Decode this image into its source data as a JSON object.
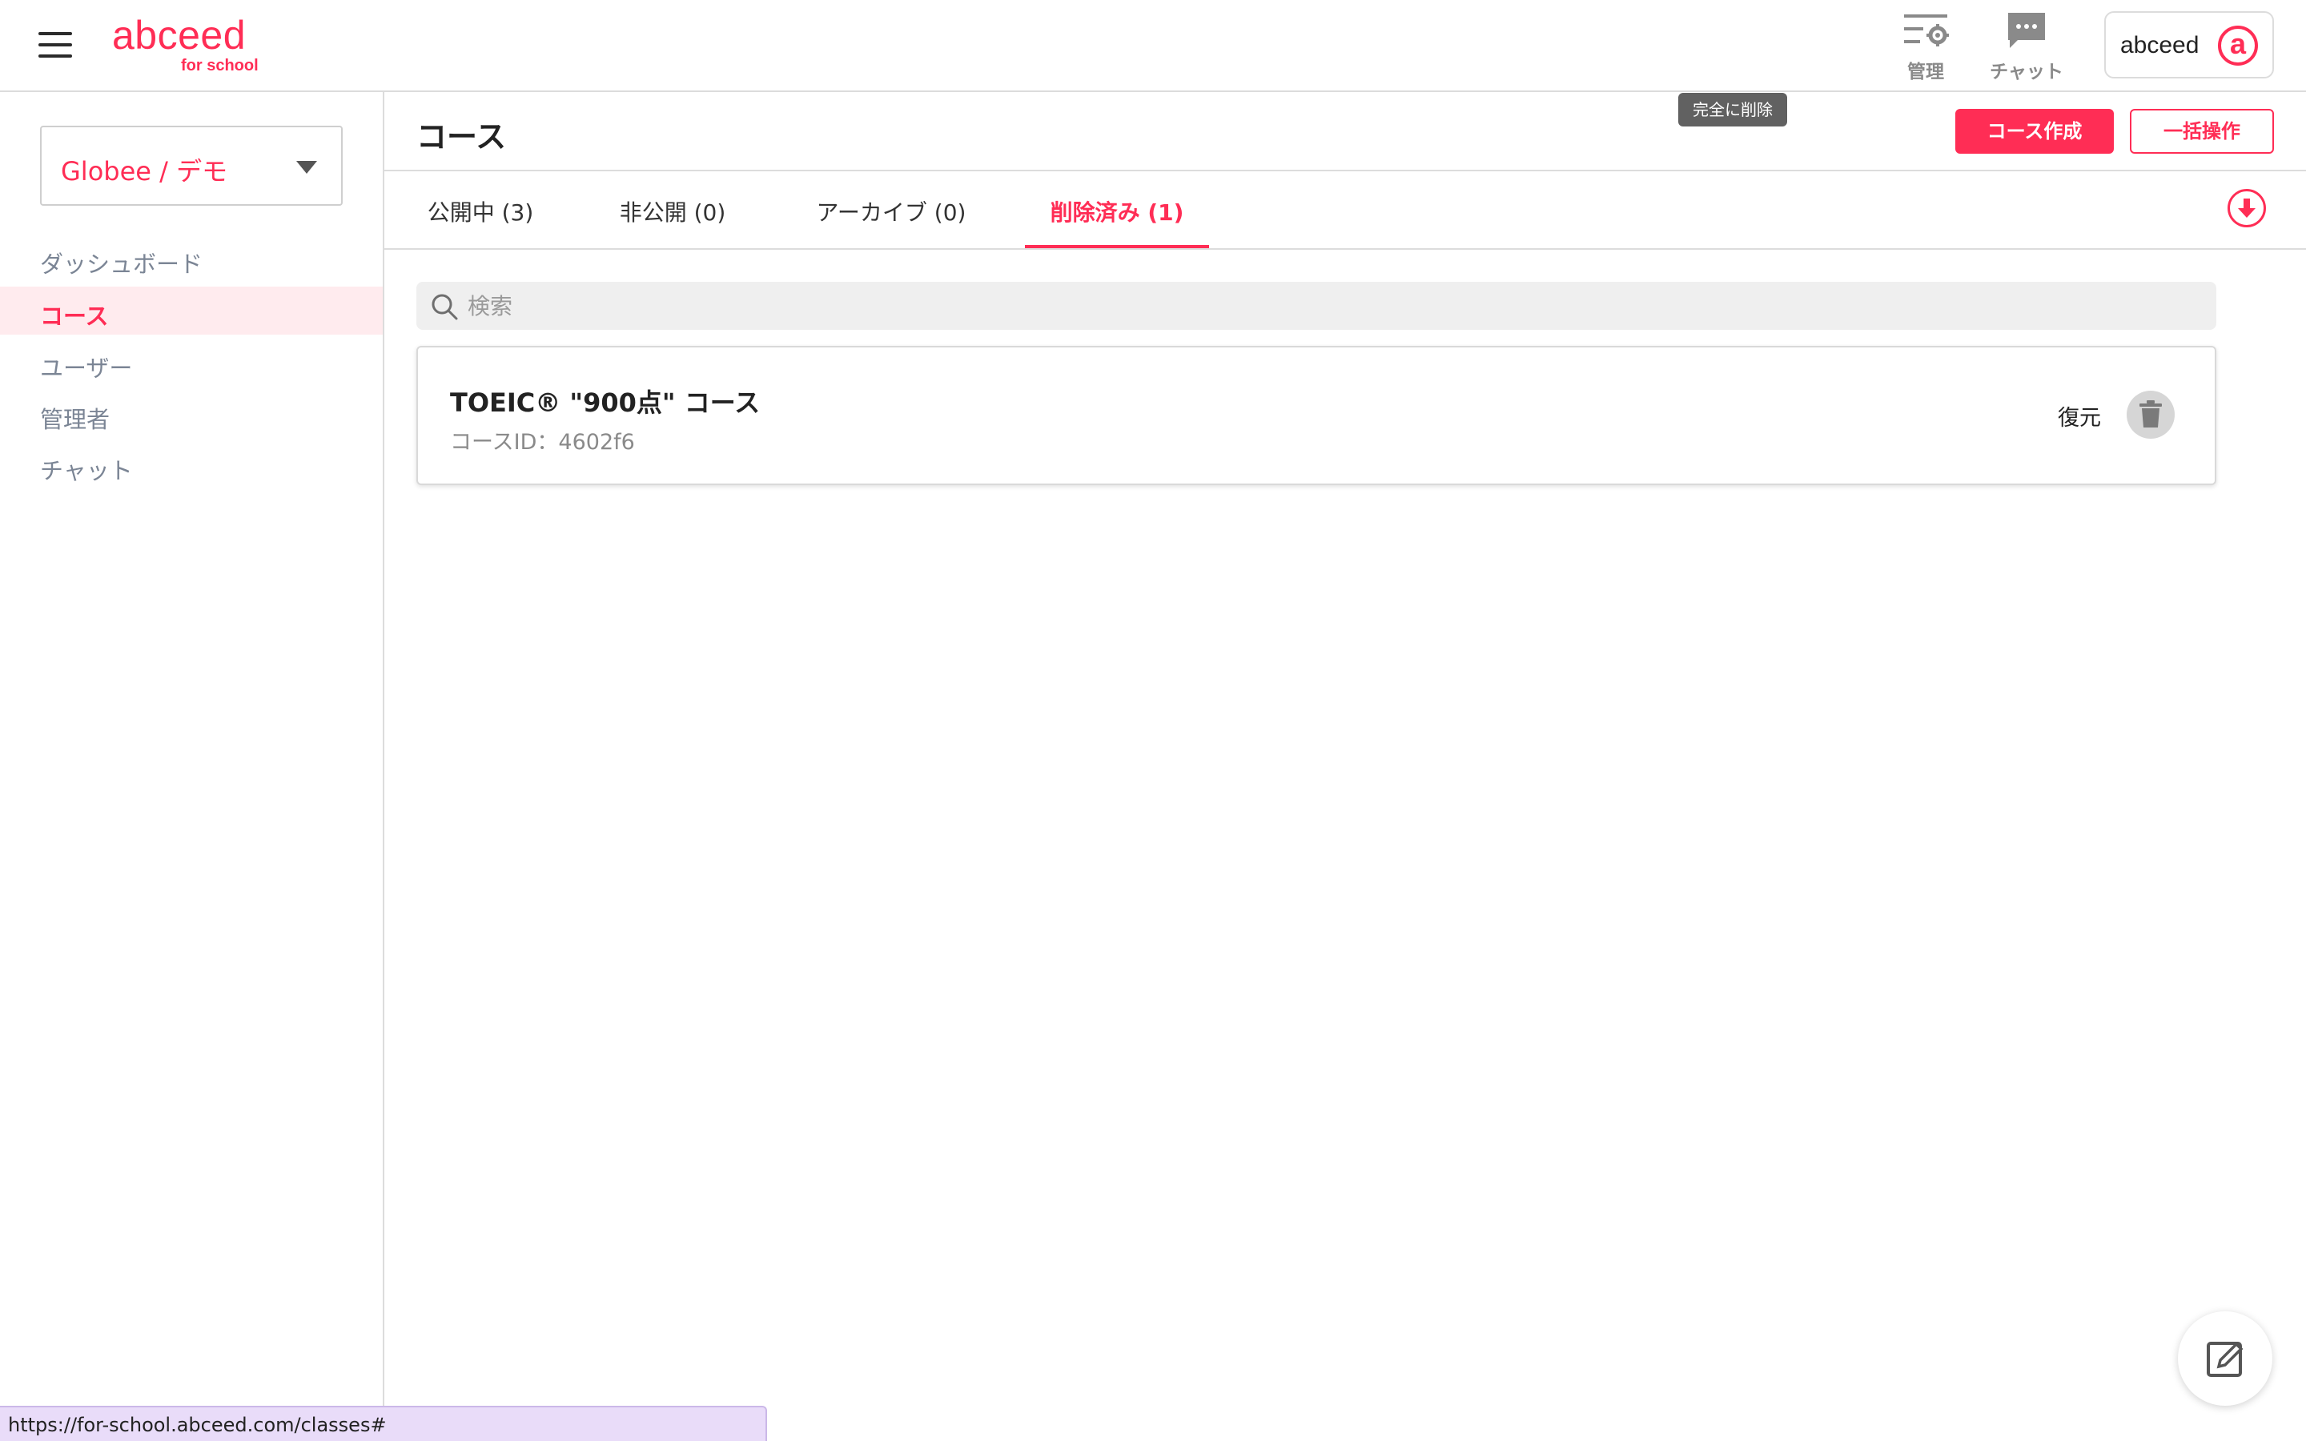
{
  "header": {
    "logo_main": "abceed",
    "logo_sub": "for school",
    "admin_label": "管理",
    "chat_label": "チャット",
    "account_name": "abceed",
    "account_badge": "a"
  },
  "sidebar": {
    "org_select_value": "Globee / デモ",
    "items": [
      {
        "label": "ダッシュボード",
        "active": false
      },
      {
        "label": "コース",
        "active": true
      },
      {
        "label": "ユーザー",
        "active": false
      },
      {
        "label": "管理者",
        "active": false
      },
      {
        "label": "チャット",
        "active": false
      }
    ]
  },
  "main": {
    "title": "コース",
    "create_button": "コース作成",
    "bulk_button": "一括操作",
    "tabs": [
      {
        "label": "公開中 (3)",
        "active": false
      },
      {
        "label": "非公開 (0)",
        "active": false
      },
      {
        "label": "アーカイブ (0)",
        "active": false
      },
      {
        "label": "削除済み (1)",
        "active": true
      }
    ],
    "search_placeholder": "検索",
    "courses": [
      {
        "title": "TOEIC® \"900点\" コース",
        "course_id": "コースID：4602f6",
        "restore_label": "復元",
        "delete_tooltip": "完全に削除"
      }
    ]
  },
  "statusbar": {
    "url": "https://for-school.abceed.com/classes#"
  },
  "colors": {
    "accent": "#ff2d55",
    "active_bg": "#ffebee",
    "nav_text": "#7b8595"
  },
  "icons": {
    "menu": "hamburger-icon",
    "admin": "settings-list-icon",
    "chat": "chat-bubble-icon",
    "download": "download-circle-icon",
    "search": "search-icon",
    "trash": "trash-icon",
    "fab": "edit-icon"
  }
}
